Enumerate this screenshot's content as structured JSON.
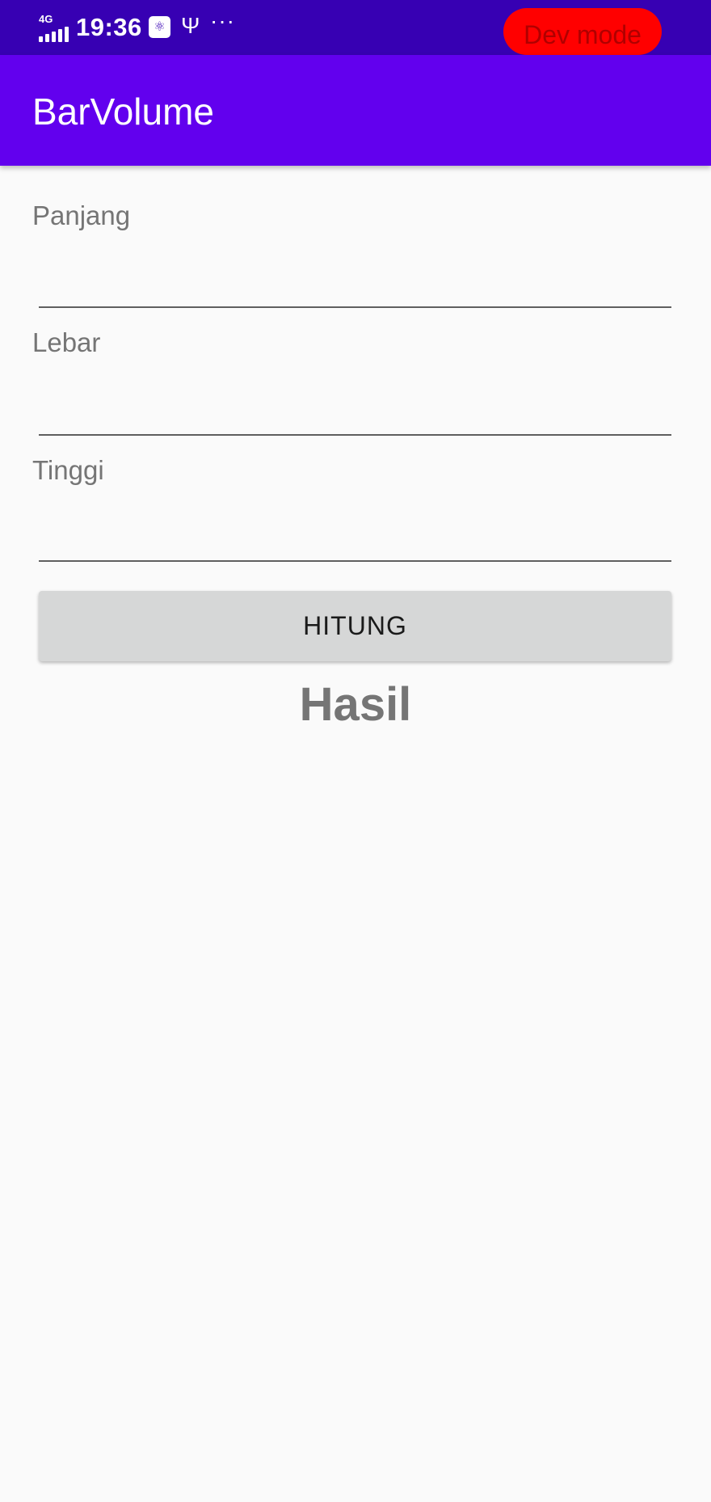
{
  "status_bar": {
    "network": "4G",
    "time": "19:36",
    "usb_badge_icon": "usb-debug-icon",
    "usb_icon": "usb-icon",
    "more_icon": "more-dots-icon",
    "more": "···"
  },
  "dev_mode": {
    "label": "Dev mode"
  },
  "app_bar": {
    "title": "BarVolume"
  },
  "form": {
    "fields": [
      {
        "label": "Panjang",
        "value": ""
      },
      {
        "label": "Lebar",
        "value": ""
      },
      {
        "label": "Tinggi",
        "value": ""
      }
    ],
    "button_label": "HITUNG"
  },
  "result": {
    "text": "Hasil"
  },
  "colors": {
    "status_bar": "#3700b3",
    "app_bar": "#6200ee",
    "dev_pill": "#ff0000",
    "button": "#d6d7d7",
    "label_text": "#757575"
  }
}
